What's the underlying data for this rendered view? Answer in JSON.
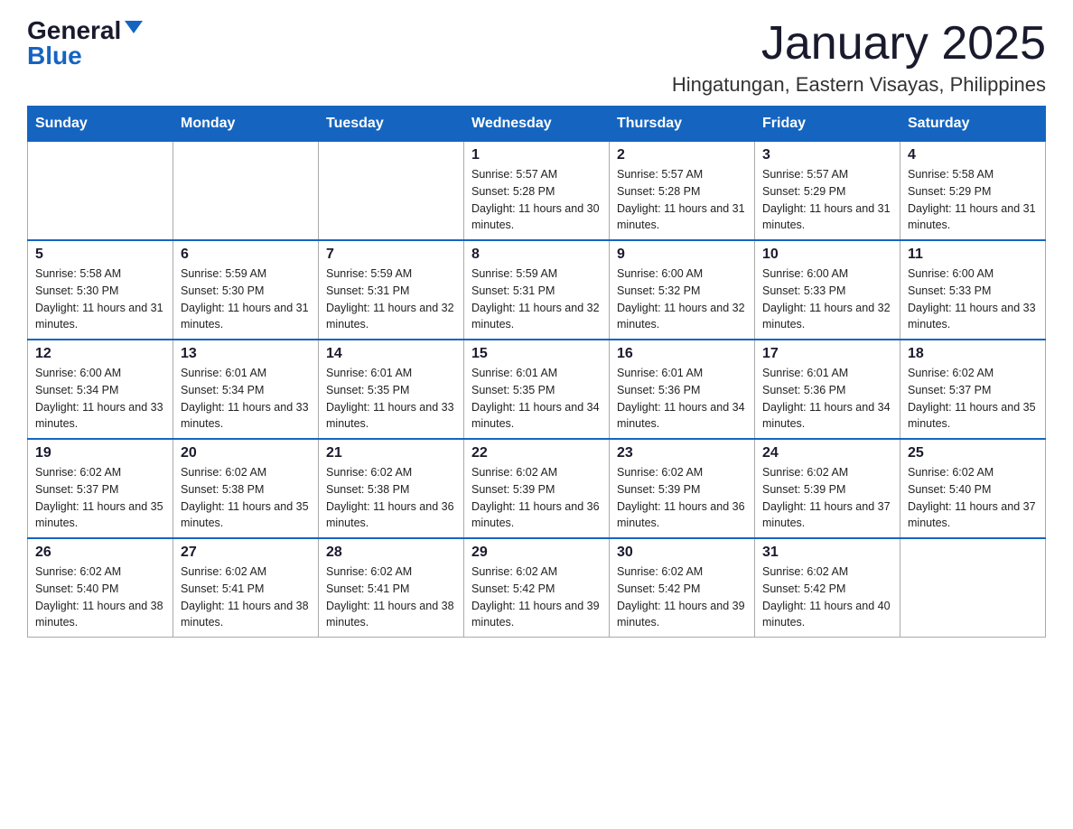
{
  "logo": {
    "general": "General",
    "blue": "Blue"
  },
  "title": "January 2025",
  "subtitle": "Hingatungan, Eastern Visayas, Philippines",
  "days_of_week": [
    "Sunday",
    "Monday",
    "Tuesday",
    "Wednesday",
    "Thursday",
    "Friday",
    "Saturday"
  ],
  "weeks": [
    [
      {
        "day": "",
        "info": ""
      },
      {
        "day": "",
        "info": ""
      },
      {
        "day": "",
        "info": ""
      },
      {
        "day": "1",
        "info": "Sunrise: 5:57 AM\nSunset: 5:28 PM\nDaylight: 11 hours and 30 minutes."
      },
      {
        "day": "2",
        "info": "Sunrise: 5:57 AM\nSunset: 5:28 PM\nDaylight: 11 hours and 31 minutes."
      },
      {
        "day": "3",
        "info": "Sunrise: 5:57 AM\nSunset: 5:29 PM\nDaylight: 11 hours and 31 minutes."
      },
      {
        "day": "4",
        "info": "Sunrise: 5:58 AM\nSunset: 5:29 PM\nDaylight: 11 hours and 31 minutes."
      }
    ],
    [
      {
        "day": "5",
        "info": "Sunrise: 5:58 AM\nSunset: 5:30 PM\nDaylight: 11 hours and 31 minutes."
      },
      {
        "day": "6",
        "info": "Sunrise: 5:59 AM\nSunset: 5:30 PM\nDaylight: 11 hours and 31 minutes."
      },
      {
        "day": "7",
        "info": "Sunrise: 5:59 AM\nSunset: 5:31 PM\nDaylight: 11 hours and 32 minutes."
      },
      {
        "day": "8",
        "info": "Sunrise: 5:59 AM\nSunset: 5:31 PM\nDaylight: 11 hours and 32 minutes."
      },
      {
        "day": "9",
        "info": "Sunrise: 6:00 AM\nSunset: 5:32 PM\nDaylight: 11 hours and 32 minutes."
      },
      {
        "day": "10",
        "info": "Sunrise: 6:00 AM\nSunset: 5:33 PM\nDaylight: 11 hours and 32 minutes."
      },
      {
        "day": "11",
        "info": "Sunrise: 6:00 AM\nSunset: 5:33 PM\nDaylight: 11 hours and 33 minutes."
      }
    ],
    [
      {
        "day": "12",
        "info": "Sunrise: 6:00 AM\nSunset: 5:34 PM\nDaylight: 11 hours and 33 minutes."
      },
      {
        "day": "13",
        "info": "Sunrise: 6:01 AM\nSunset: 5:34 PM\nDaylight: 11 hours and 33 minutes."
      },
      {
        "day": "14",
        "info": "Sunrise: 6:01 AM\nSunset: 5:35 PM\nDaylight: 11 hours and 33 minutes."
      },
      {
        "day": "15",
        "info": "Sunrise: 6:01 AM\nSunset: 5:35 PM\nDaylight: 11 hours and 34 minutes."
      },
      {
        "day": "16",
        "info": "Sunrise: 6:01 AM\nSunset: 5:36 PM\nDaylight: 11 hours and 34 minutes."
      },
      {
        "day": "17",
        "info": "Sunrise: 6:01 AM\nSunset: 5:36 PM\nDaylight: 11 hours and 34 minutes."
      },
      {
        "day": "18",
        "info": "Sunrise: 6:02 AM\nSunset: 5:37 PM\nDaylight: 11 hours and 35 minutes."
      }
    ],
    [
      {
        "day": "19",
        "info": "Sunrise: 6:02 AM\nSunset: 5:37 PM\nDaylight: 11 hours and 35 minutes."
      },
      {
        "day": "20",
        "info": "Sunrise: 6:02 AM\nSunset: 5:38 PM\nDaylight: 11 hours and 35 minutes."
      },
      {
        "day": "21",
        "info": "Sunrise: 6:02 AM\nSunset: 5:38 PM\nDaylight: 11 hours and 36 minutes."
      },
      {
        "day": "22",
        "info": "Sunrise: 6:02 AM\nSunset: 5:39 PM\nDaylight: 11 hours and 36 minutes."
      },
      {
        "day": "23",
        "info": "Sunrise: 6:02 AM\nSunset: 5:39 PM\nDaylight: 11 hours and 36 minutes."
      },
      {
        "day": "24",
        "info": "Sunrise: 6:02 AM\nSunset: 5:39 PM\nDaylight: 11 hours and 37 minutes."
      },
      {
        "day": "25",
        "info": "Sunrise: 6:02 AM\nSunset: 5:40 PM\nDaylight: 11 hours and 37 minutes."
      }
    ],
    [
      {
        "day": "26",
        "info": "Sunrise: 6:02 AM\nSunset: 5:40 PM\nDaylight: 11 hours and 38 minutes."
      },
      {
        "day": "27",
        "info": "Sunrise: 6:02 AM\nSunset: 5:41 PM\nDaylight: 11 hours and 38 minutes."
      },
      {
        "day": "28",
        "info": "Sunrise: 6:02 AM\nSunset: 5:41 PM\nDaylight: 11 hours and 38 minutes."
      },
      {
        "day": "29",
        "info": "Sunrise: 6:02 AM\nSunset: 5:42 PM\nDaylight: 11 hours and 39 minutes."
      },
      {
        "day": "30",
        "info": "Sunrise: 6:02 AM\nSunset: 5:42 PM\nDaylight: 11 hours and 39 minutes."
      },
      {
        "day": "31",
        "info": "Sunrise: 6:02 AM\nSunset: 5:42 PM\nDaylight: 11 hours and 40 minutes."
      },
      {
        "day": "",
        "info": ""
      }
    ]
  ]
}
